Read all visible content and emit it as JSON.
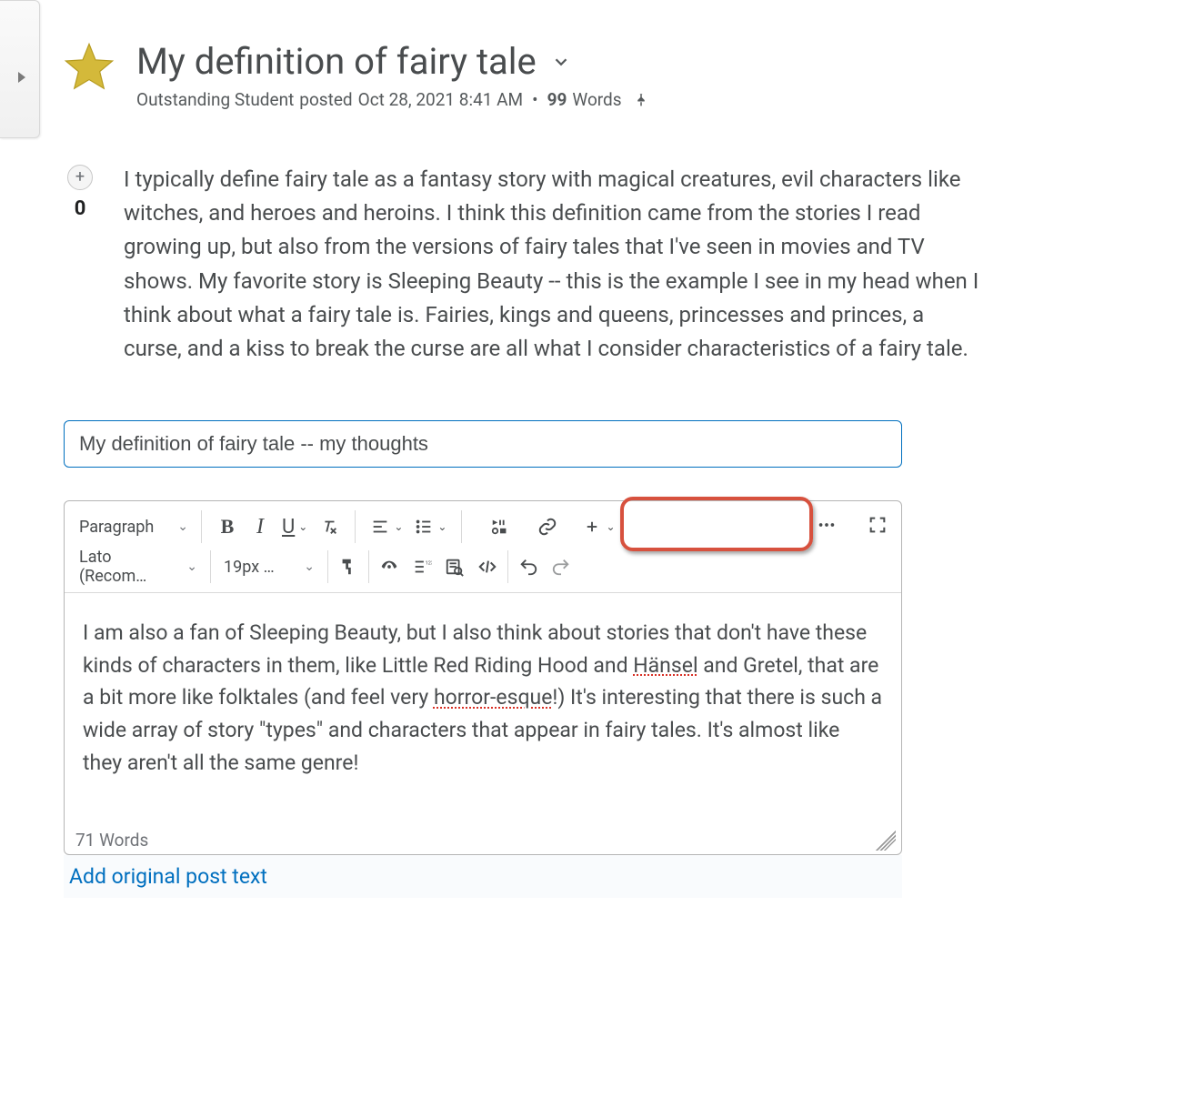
{
  "post": {
    "title": "My definition of fairy tale",
    "author": "Outstanding Student",
    "posted_verb": "posted",
    "timestamp": "Oct 28, 2021 8:41 AM",
    "word_count": "99",
    "word_count_label": "Words",
    "body": "I typically define fairy tale as a fantasy story with magical creatures, evil characters like witches, and heroes and heroins. I think this definition came from the stories I read growing up, but also from the versions of fairy tales that I've seen in movies and TV shows. My favorite story is Sleeping Beauty -- this is the example I see in my head when I think about what a fairy tale is. Fairies, kings and queens, princesses and princes, a curse, and a kiss to break the curse are all what I consider characteristics of a fairy tale.",
    "vote_count": "0"
  },
  "reply": {
    "subject": "My definition of fairy tale -- my thoughts",
    "body_pre": "I am also a fan of Sleeping Beauty, but I also think about stories that don't have these kinds of characters in them, like Little Red Riding Hood and ",
    "body_sp1": "Hänsel",
    "body_mid": " and Gretel, that are a bit more like folktales (and feel very ",
    "body_sp2": "horror-esque",
    "body_post": "!) It's interesting that there is such a wide array of story \"types\" and characters that appear in fairy tales. It's almost like they aren't all the same genre!",
    "word_count": "71 Words",
    "add_original": "Add original post text"
  },
  "toolbar": {
    "block_format": "Paragraph",
    "font_family": "Lato (Recom…",
    "font_size": "19px …"
  }
}
